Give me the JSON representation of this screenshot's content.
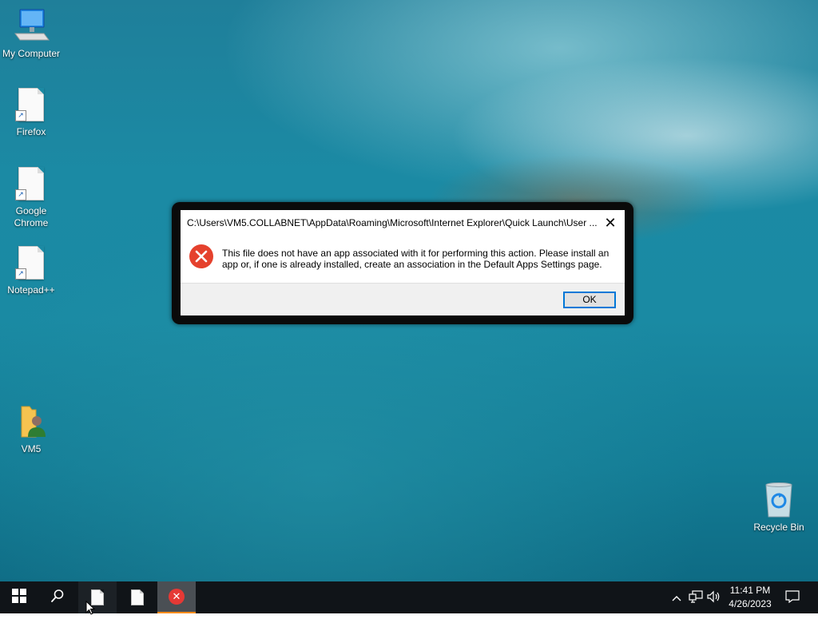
{
  "desktop": {
    "icons": [
      {
        "label": "My Computer",
        "icon": "computer-icon"
      },
      {
        "label": "Firefox",
        "icon": "document-shortcut-icon"
      },
      {
        "label": "Google Chrome",
        "icon": "document-shortcut-icon"
      },
      {
        "label": "Notepad++",
        "icon": "document-shortcut-icon"
      },
      {
        "label": "VM5",
        "icon": "user-folder-icon"
      },
      {
        "label": "Recycle Bin",
        "icon": "recycle-bin-icon"
      }
    ]
  },
  "dialog": {
    "title": "C:\\Users\\VM5.COLLABNET\\AppData\\Roaming\\Microsoft\\Internet Explorer\\Quick Launch\\User ...",
    "close_glyph": "✕",
    "message": "This file does not have an app associated with it for performing this action. Please install an app or, if one is already installed, create an association in the Default Apps Settings page.",
    "ok_label": "OK",
    "icon": "error-icon",
    "error_color": "#e5412d"
  },
  "taskbar": {
    "start_icon": "windows-start-icon",
    "search_icon": "search-icon",
    "apps": [
      {
        "icon": "document-icon"
      },
      {
        "icon": "document-icon"
      },
      {
        "icon": "error-app-icon",
        "active": true
      }
    ],
    "tray": {
      "chevron": "^",
      "network_icon": "network-icon",
      "volume_icon": "volume-icon",
      "time": "11:41 PM",
      "date": "4/26/2023",
      "notification_icon": "notification-icon"
    },
    "accent_color": "#ff8c1a"
  }
}
